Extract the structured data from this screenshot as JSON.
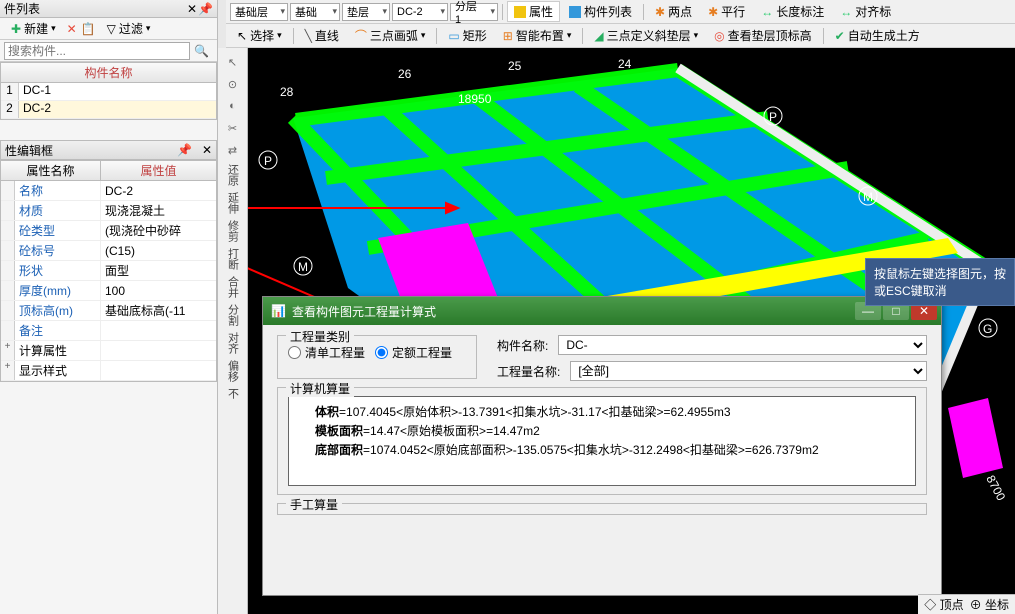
{
  "toolbars": {
    "drop1": "基础层",
    "drop2": "基础",
    "drop3": "垫层",
    "drop4": "DC-2",
    "drop5": "分层1",
    "attr_btn": "属性",
    "list_btn": "构件列表",
    "two_point": "两点",
    "parallel": "平行",
    "length_dim": "长度标注",
    "align_dim": "对齐标",
    "select": "选择",
    "line": "直线",
    "arc3": "三点画弧",
    "rect": "矩形",
    "smart": "智能布置",
    "slope3": "三点定义斜垫层",
    "check_top": "查看垫层顶标高",
    "auto_soil": "自动生成土方"
  },
  "left": {
    "panel_title": "件列表",
    "new_btn": "新建",
    "filter_btn": "过滤",
    "search_placeholder": "搜索构件...",
    "table_header": "构件名称",
    "items": [
      {
        "idx": "1",
        "name": "DC-1"
      },
      {
        "idx": "2",
        "name": "DC-2"
      }
    ]
  },
  "props": {
    "title": "性编辑框",
    "col_name": "属性名称",
    "col_value": "属性值",
    "rows": [
      {
        "k": "名称",
        "v": "DC-2"
      },
      {
        "k": "材质",
        "v": "现浇混凝土"
      },
      {
        "k": "砼类型",
        "v": "(现浇砼中砂碎"
      },
      {
        "k": "砼标号",
        "v": "(C15)"
      },
      {
        "k": "形状",
        "v": "面型"
      },
      {
        "k": "厚度(mm)",
        "v": "100"
      },
      {
        "k": "顶标高(m)",
        "v": "基础底标高(-11"
      },
      {
        "k": "备注",
        "v": ""
      }
    ],
    "expand1": "计算属性",
    "expand2": "显示样式"
  },
  "vtool": {
    "labels": [
      "还原",
      "延伸",
      "修剪",
      "打断",
      "合并",
      "分割",
      "对齐",
      "偏移",
      "不"
    ]
  },
  "dialog": {
    "title": "查看构件图元工程量计算式",
    "min": "—",
    "max": "□",
    "close": "✕",
    "group1": "工程量类别",
    "radio1": "清单工程量",
    "radio2": "定额工程量",
    "label_name": "构件名称:",
    "val_name": "DC-",
    "label_eng": "工程量名称:",
    "val_eng": "[全部]",
    "group2": "计算机算量",
    "lines": [
      {
        "b": "体积",
        "t": "=107.4045<原始体积>-13.7391<扣集水坑>-31.17<扣基础梁>=62.4955m3"
      },
      {
        "b": "模板面积",
        "t": "=14.47<原始模板面积>=14.47m2"
      },
      {
        "b": "底部面积",
        "t": "=1074.0452<原始底部面积>-135.0575<扣集水坑>-312.2498<扣基础梁>=626.7379m2"
      }
    ],
    "group3": "手工算量"
  },
  "hint": {
    "l1": "按鼠标左键选择图元，按",
    "l2": "或ESC键取消"
  },
  "status": {
    "origin": "顶点",
    "coord": "坐标"
  },
  "model": {
    "labels": [
      "28",
      "26",
      "25",
      "24"
    ],
    "dim": "18950",
    "letters": [
      "P",
      "P",
      "M",
      "M",
      "G"
    ],
    "side": "8700"
  }
}
